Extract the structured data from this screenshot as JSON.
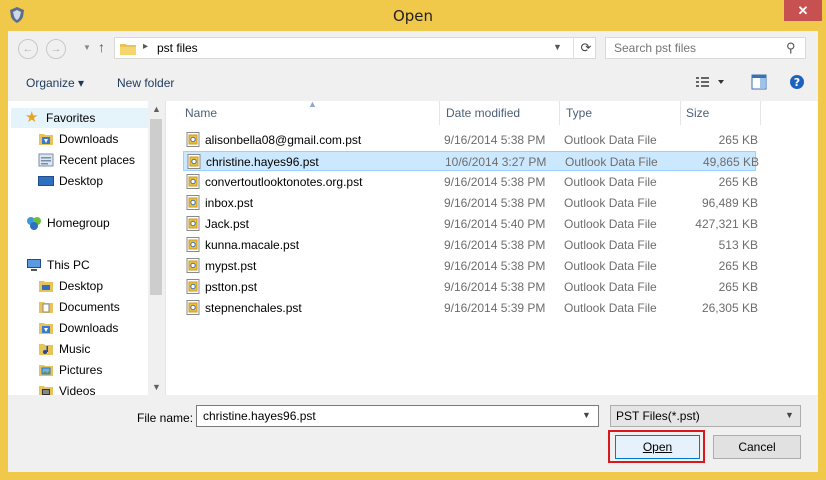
{
  "window": {
    "title": "Open",
    "close_glyph": "✕"
  },
  "navbar": {
    "back_glyph": "←",
    "forward_glyph": "→",
    "up_glyph": "↑",
    "address_path": "pst files",
    "search_placeholder": "Search pst files"
  },
  "toolbar": {
    "organize_label": "Organize ▾",
    "new_folder_label": "New folder"
  },
  "nav_pane": {
    "items": [
      {
        "label": "Favorites",
        "icon": "star-icon"
      },
      {
        "label": "Downloads",
        "icon": "downloads-folder-icon"
      },
      {
        "label": "Recent places",
        "icon": "recent-places-icon"
      },
      {
        "label": "Desktop",
        "icon": "desktop-icon"
      },
      {
        "label": "Homegroup",
        "icon": "homegroup-icon"
      },
      {
        "label": "This PC",
        "icon": "computer-icon"
      },
      {
        "label": "Desktop",
        "icon": "desktop-folder-icon"
      },
      {
        "label": "Documents",
        "icon": "documents-folder-icon"
      },
      {
        "label": "Downloads",
        "icon": "downloads-folder-icon"
      },
      {
        "label": "Music",
        "icon": "music-folder-icon"
      },
      {
        "label": "Pictures",
        "icon": "pictures-folder-icon"
      },
      {
        "label": "Videos",
        "icon": "videos-folder-icon"
      }
    ]
  },
  "columns": {
    "name": "Name",
    "date": "Date modified",
    "type": "Type",
    "size": "Size"
  },
  "files": [
    {
      "name": "alisonbella08@gmail.com.pst",
      "date": "9/16/2014 5:38 PM",
      "type": "Outlook Data File",
      "size": "265 KB"
    },
    {
      "name": "christine.hayes96.pst",
      "date": "10/6/2014 3:27 PM",
      "type": "Outlook Data File",
      "size": "49,865 KB"
    },
    {
      "name": "convertoutlooktonotes.org.pst",
      "date": "9/16/2014 5:38 PM",
      "type": "Outlook Data File",
      "size": "265 KB"
    },
    {
      "name": "inbox.pst",
      "date": "9/16/2014 5:38 PM",
      "type": "Outlook Data File",
      "size": "96,489 KB"
    },
    {
      "name": "Jack.pst",
      "date": "9/16/2014 5:40 PM",
      "type": "Outlook Data File",
      "size": "427,321 KB"
    },
    {
      "name": "kunna.macale.pst",
      "date": "9/16/2014 5:38 PM",
      "type": "Outlook Data File",
      "size": "513 KB"
    },
    {
      "name": "mypst.pst",
      "date": "9/16/2014 5:38 PM",
      "type": "Outlook Data File",
      "size": "265 KB"
    },
    {
      "name": "pstton.pst",
      "date": "9/16/2014 5:38 PM",
      "type": "Outlook Data File",
      "size": "265 KB"
    },
    {
      "name": "stepnenchales.pst",
      "date": "9/16/2014 5:39 PM",
      "type": "Outlook Data File",
      "size": "26,305 KB"
    }
  ],
  "bottom": {
    "file_name_label": "File name:",
    "file_name_value": "christine.hayes96.pst",
    "file_type": "PST Files(*.pst)",
    "open_label": "Open",
    "cancel_label": "Cancel"
  },
  "colors": {
    "frame": "#f0c84a",
    "selection": "#cce8ff",
    "close": "#c75050",
    "highlight_outline": "#d9181e"
  }
}
